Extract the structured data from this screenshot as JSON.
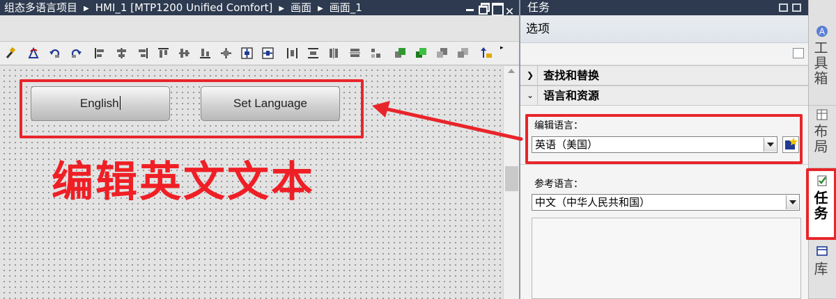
{
  "editor": {
    "breadcrumb": [
      "组态多语言项目",
      "HMI_1 [MTP1200 Unified Comfort]",
      "画面",
      "画面_1"
    ],
    "window_controls": [
      "minimize",
      "restore",
      "maximize",
      "close"
    ],
    "close_glyph": "✕",
    "toolbar_icons": [
      "format-painter-icon",
      "rotate-left-icon",
      "rotate-ccw-icon",
      "rotate-cw-icon",
      "align-left-icon",
      "align-center-icon",
      "align-right-icon",
      "align-top-icon",
      "align-middle-icon",
      "align-bottom-icon",
      "center-plus-icon",
      "center-horizontal-icon",
      "center-vertical-icon",
      "distribute-horizontal-icon",
      "distribute-vertical-icon",
      "same-height-icon",
      "same-width-icon",
      "same-size-icon",
      "bring-to-front-icon",
      "bring-forward-icon",
      "send-backward-icon",
      "send-to-back-icon",
      "tab-order-icon"
    ],
    "toolbar_more_glyph": "▸",
    "canvas": {
      "buttons": [
        {
          "label": "English",
          "editing": true
        },
        {
          "label": "Set Language",
          "editing": false
        }
      ]
    },
    "annotation_text": "编辑英文文本"
  },
  "task_card": {
    "title": "任务",
    "options_label": "选项",
    "sections": [
      {
        "label": "查找和替换",
        "expanded": false,
        "chevron": "❯"
      },
      {
        "label": "语言和资源",
        "expanded": true,
        "chevron": "⌄"
      }
    ],
    "edit_language": {
      "label": "编辑语言：",
      "value": "英语（美国）"
    },
    "reference_language": {
      "label": "参考语言：",
      "value": "中文（中华人民共和国）"
    }
  },
  "side_tabs": [
    {
      "label": "工具箱",
      "icon": "toolbox-icon",
      "active": false
    },
    {
      "label": "布局",
      "icon": "layout-icon",
      "active": false
    },
    {
      "label": "任务",
      "icon": "tasks-icon",
      "active": true
    },
    {
      "label": "库",
      "icon": "library-icon",
      "active": false
    }
  ],
  "colors": {
    "title_bar": "#2d3a4f",
    "highlight": "#e8252a",
    "annotation": "#ef1f25",
    "task_tab_icon_accent": "#2e8b2e"
  }
}
